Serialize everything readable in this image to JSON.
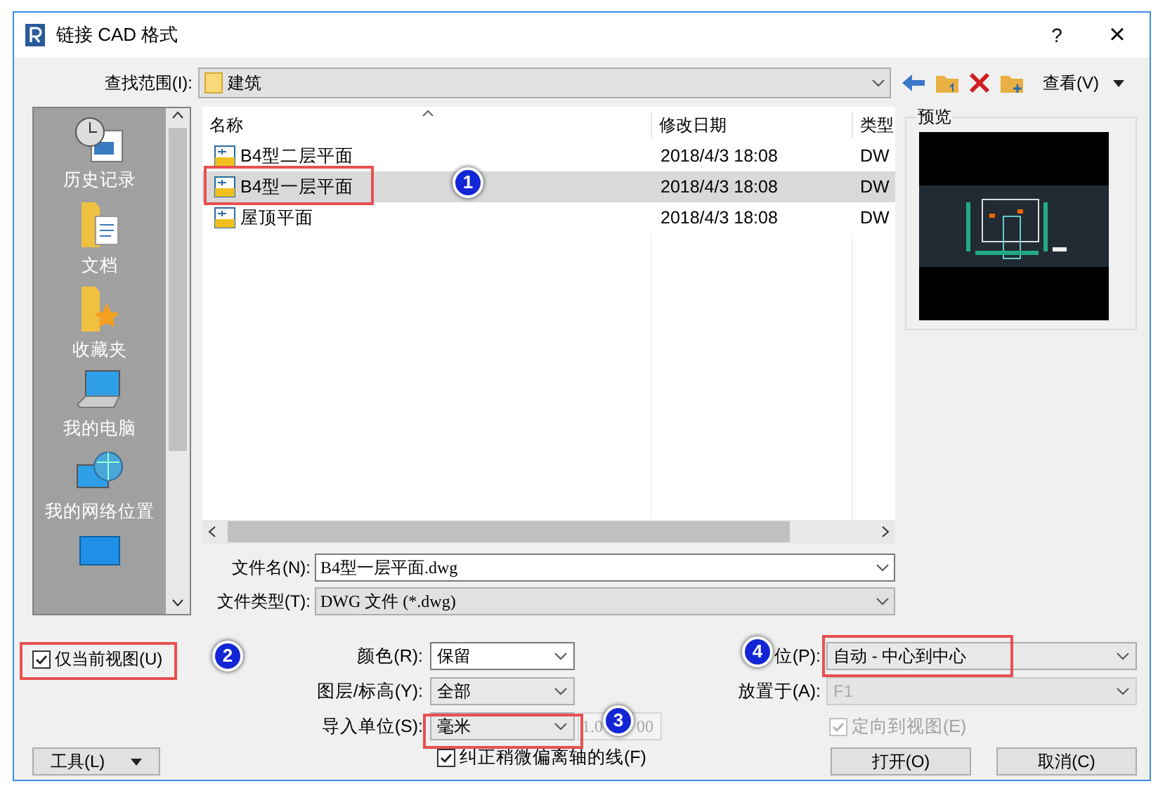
{
  "window": {
    "title": "链接 CAD 格式",
    "help": "?",
    "close": "×"
  },
  "look_in": {
    "label": "查找范围(I):",
    "value": "建筑"
  },
  "toolbar": {
    "view_label": "查看(V)"
  },
  "places": [
    {
      "kind": "history",
      "label": "历史记录"
    },
    {
      "kind": "documents",
      "label": "文档"
    },
    {
      "kind": "favorites",
      "label": "收藏夹"
    },
    {
      "kind": "computer",
      "label": "我的电脑"
    },
    {
      "kind": "network",
      "label": "我的网络位置"
    },
    {
      "kind": "desktop"
    }
  ],
  "file_list": {
    "columns": [
      "名称",
      "修改日期",
      "类型"
    ],
    "rows": [
      {
        "name": "B4型二层平面",
        "date": "2018/4/3 18:08",
        "type": "DW",
        "selected": false
      },
      {
        "name": "B4型一层平面",
        "date": "2018/4/3 18:08",
        "type": "DW",
        "selected": true
      },
      {
        "name": "屋顶平面",
        "date": "2018/4/3 18:08",
        "type": "DW",
        "selected": false
      }
    ]
  },
  "preview": {
    "label": "预览"
  },
  "file_name": {
    "label": "文件名(N):",
    "value": "B4型一层平面.dwg"
  },
  "file_type": {
    "label": "文件类型(T):",
    "value": "DWG 文件 (*.dwg)"
  },
  "current_view_only": {
    "label": "仅当前视图(U)",
    "checked": true
  },
  "options_left": [
    {
      "label": "颜色(R):",
      "value": "保留",
      "disabled": false
    },
    {
      "label": "图层/标高(Y):",
      "value": "全部",
      "disabled": false
    },
    {
      "label": "导入单位(S):",
      "value": "毫米",
      "disabled": false,
      "scale_parts": [
        "1.0",
        "00"
      ]
    }
  ],
  "correct_lines": {
    "label": "纠正稍微偏离轴的线(F)",
    "checked": true
  },
  "options_right": [
    {
      "label": "位(P):",
      "value": "自动 - 中心到中心",
      "disabled": false
    },
    {
      "label": "放置于(A):",
      "value": "F1",
      "disabled": true
    }
  ],
  "orient_to_view": {
    "label": "定向到视图(E)",
    "checked": true,
    "disabled": true
  },
  "buttons": {
    "tools": "工具(L)",
    "open": "打开(O)",
    "cancel": "取消(C)"
  },
  "annotations": [
    {
      "number": "1"
    },
    {
      "number": "2"
    },
    {
      "number": "3"
    },
    {
      "number": "4"
    }
  ]
}
